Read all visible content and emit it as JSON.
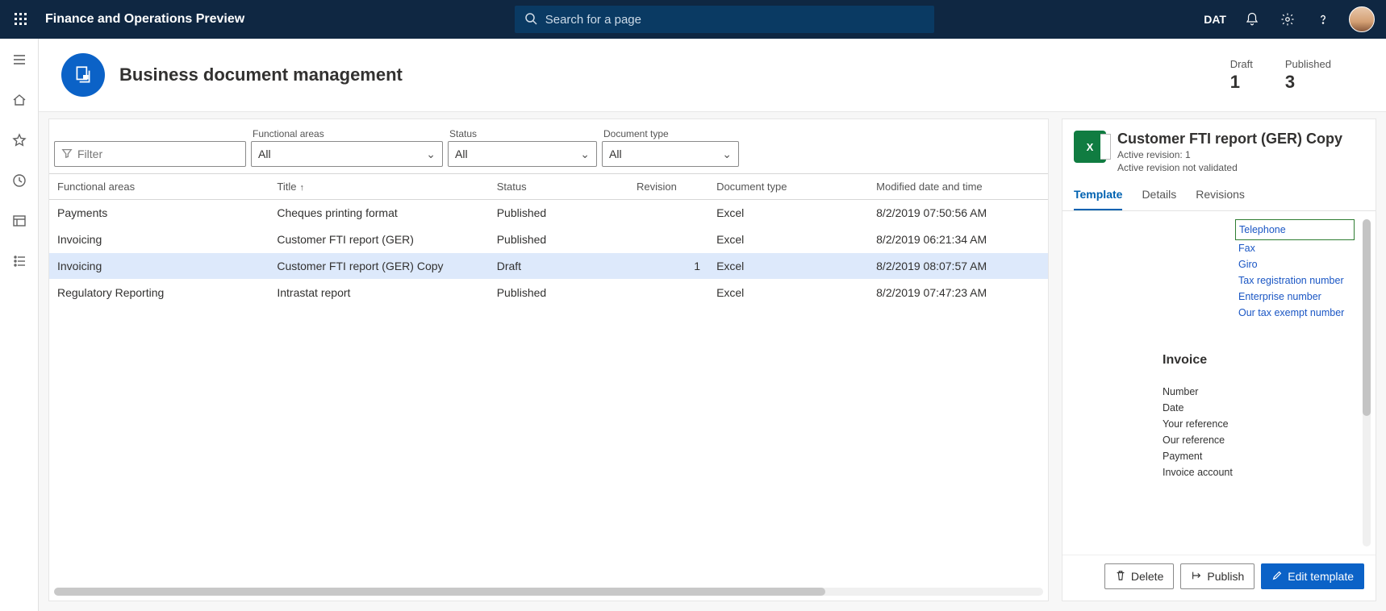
{
  "header": {
    "app_title": "Finance and Operations Preview",
    "search_placeholder": "Search for a page",
    "company": "DAT"
  },
  "page": {
    "title": "Business document management",
    "stats": {
      "draft_label": "Draft",
      "draft_count": "1",
      "published_label": "Published",
      "published_count": "3"
    }
  },
  "filters": {
    "filter_placeholder": "Filter",
    "functional_areas_label": "Functional areas",
    "functional_areas_value": "All",
    "status_label": "Status",
    "status_value": "All",
    "doc_type_label": "Document type",
    "doc_type_value": "All"
  },
  "grid": {
    "headers": {
      "fa": "Functional areas",
      "title": "Title",
      "status": "Status",
      "revision": "Revision",
      "doctype": "Document type",
      "modified": "Modified date and time"
    },
    "sort_indicator": "↑",
    "rows": [
      {
        "selected": false,
        "fa": "Payments",
        "title": "Cheques printing format",
        "status": "Published",
        "revision": "",
        "doctype": "Excel",
        "modified": "8/2/2019 07:50:56 AM"
      },
      {
        "selected": false,
        "fa": "Invoicing",
        "title": "Customer FTI report (GER)",
        "status": "Published",
        "revision": "",
        "doctype": "Excel",
        "modified": "8/2/2019 06:21:34 AM"
      },
      {
        "selected": true,
        "fa": "Invoicing",
        "title": "Customer FTI report (GER) Copy",
        "status": "Draft",
        "revision": "1",
        "doctype": "Excel",
        "modified": "8/2/2019 08:07:57 AM"
      },
      {
        "selected": false,
        "fa": "Regulatory Reporting",
        "title": "Intrastat report",
        "status": "Published",
        "revision": "",
        "doctype": "Excel",
        "modified": "8/2/2019 07:47:23 AM"
      }
    ]
  },
  "details": {
    "title": "Customer FTI report (GER) Copy",
    "sub1": "Active revision: 1",
    "sub2": "Active revision not validated",
    "tabs": {
      "template": "Template",
      "details": "Details",
      "revisions": "Revisions"
    },
    "preview": {
      "boxed_fields": [
        "Telephone"
      ],
      "link_fields_after_box": [
        "Fax",
        "Giro",
        "Tax registration number",
        "Enterprise number",
        "Our tax exempt number"
      ],
      "heading": "Invoice",
      "plain_fields": [
        "Number",
        "Date",
        "Your reference",
        "Our reference",
        "Payment",
        "Invoice account"
      ]
    },
    "actions": {
      "delete": "Delete",
      "publish": "Publish",
      "edit": "Edit template"
    }
  }
}
